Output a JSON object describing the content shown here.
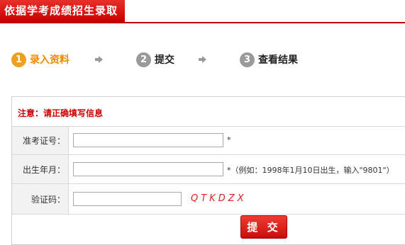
{
  "header": {
    "title": "依据学考成绩招生录取"
  },
  "steps": [
    {
      "num": "1",
      "label": "录入资料",
      "active": true
    },
    {
      "num": "2",
      "label": "提交",
      "active": false
    },
    {
      "num": "3",
      "label": "查看结果",
      "active": false
    }
  ],
  "form": {
    "notice": "注意：请正确填写信息",
    "exam_id": {
      "label": "准考证号：",
      "value": "",
      "note": "*"
    },
    "birth": {
      "label": "出生年月：",
      "value": "",
      "note": "*（例如：1998年1月10日出生，输入\"9801\"）"
    },
    "captcha": {
      "label": "验证码：",
      "value": "",
      "code": "QTKDZX"
    },
    "submit_label": "提 交"
  },
  "colors": {
    "brand_red": "#c80000",
    "active_step": "#f0a020",
    "notice": "#cc0000"
  }
}
